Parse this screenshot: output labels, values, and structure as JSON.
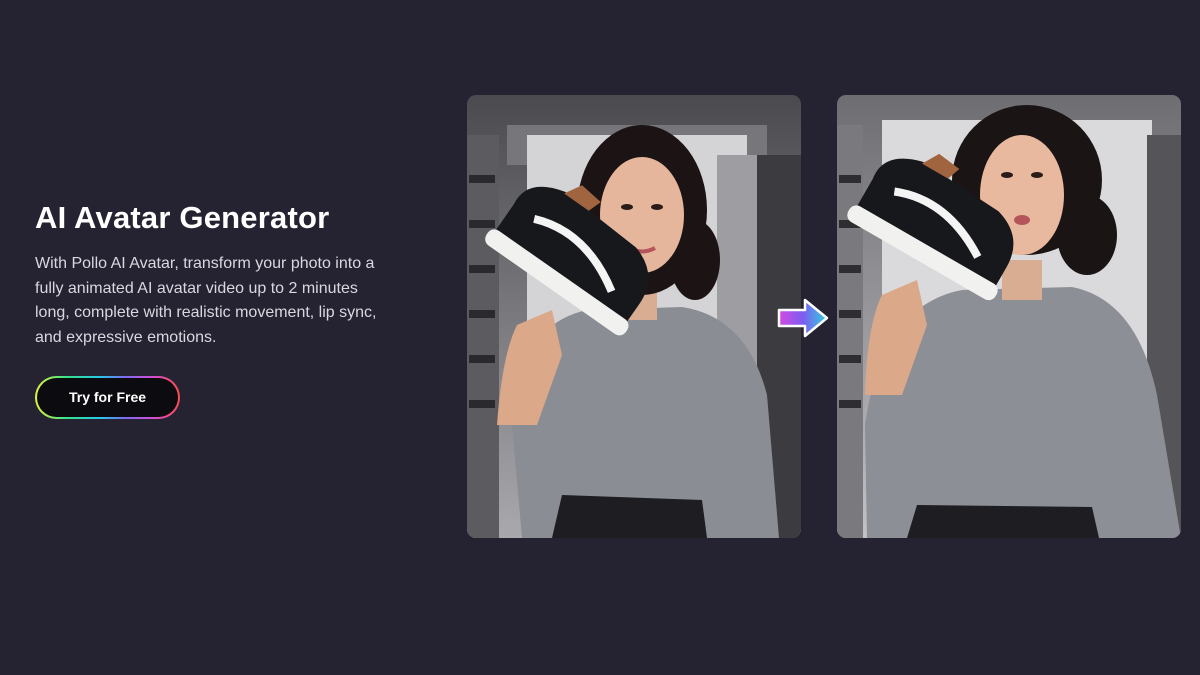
{
  "hero": {
    "title": "AI Avatar Generator",
    "description": "With Pollo AI Avatar, transform your photo into a fully animated AI avatar video up to 2 minutes long, complete with realistic movement, lip sync, and expressive emotions.",
    "cta_label": "Try for Free"
  },
  "images": {
    "before": {
      "icon": "source-photo-woman-holding-sneaker"
    },
    "after": {
      "icon": "animated-avatar-woman-holding-sneaker"
    },
    "arrow": {
      "icon": "right-arrow-icon"
    }
  },
  "colors": {
    "background": "#252331",
    "cta_gradient": [
      "#e3f33a",
      "#36e28a",
      "#26c8e8",
      "#7a6cf0",
      "#d04fd8",
      "#ff4b4b"
    ],
    "arrow_gradient": [
      "#d44be0",
      "#7d5cf0",
      "#2fd0e0"
    ]
  }
}
